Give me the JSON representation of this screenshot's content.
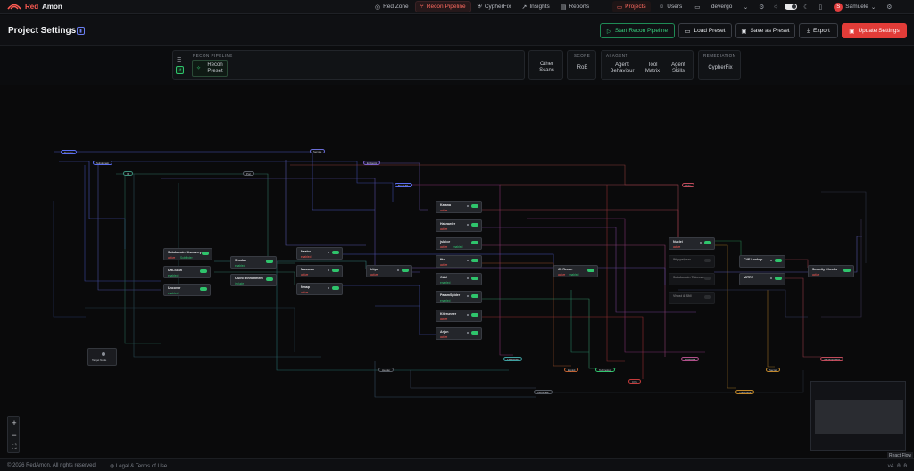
{
  "app": {
    "logo_red": "Red",
    "logo_white": "Amon"
  },
  "nav": {
    "tabs": [
      {
        "icon": "◎",
        "label": "Red Zone"
      },
      {
        "icon": "⑂",
        "label": "Recon Pipeline"
      },
      {
        "icon": "⛨",
        "label": "CypherFix"
      },
      {
        "icon": "↗",
        "label": "Insights"
      },
      {
        "icon": "▤",
        "label": "Reports"
      }
    ],
    "projects_label": "Projects",
    "users_label": "Users",
    "project_select": "devergo",
    "user_initial": "S",
    "user_name": "Samuele"
  },
  "header": {
    "title": "Project Settings",
    "start_label": "Start Recon Pipeline",
    "load_label": "Load Preset",
    "save_label": "Save as Preset",
    "export_label": "Export",
    "update_label": "Update Settings"
  },
  "sections": {
    "recon_label": "RECON PIPELINE",
    "recon_preset": "Recon Preset",
    "other_scans": "Other Scans",
    "scope_label": "SCOPE",
    "roe": "RoE",
    "ai_label": "AI AGENT",
    "agent_behaviour": "Agent Behaviour",
    "tool_matrix": "Tool Matrix",
    "agent_skills": "Agent Skills",
    "remediation_label": "REMEDIATION",
    "cypherfix": "CypherFix"
  },
  "graph": {
    "target_label": "Target Node",
    "nodes": [
      {
        "name": "Subdomain Discovery",
        "status": "active",
        "extra": "Subfinder",
        "ok": false,
        "off": false
      },
      {
        "name": "URLScan",
        "status": "enabled",
        "ok": true,
        "off": false
      },
      {
        "name": "Uncover",
        "status": "enabled",
        "ok": true,
        "off": false
      },
      {
        "name": "Shodan",
        "status": "enabled",
        "ok": true,
        "off": false
      },
      {
        "name": "OSINT Enrichment",
        "status": "include",
        "ok": true,
        "off": false
      },
      {
        "name": "Naabu",
        "status": "enabled",
        "ok": false,
        "off": false
      },
      {
        "name": "Masscan",
        "status": "active",
        "ok": false,
        "off": false
      },
      {
        "name": "Nmap",
        "status": "active",
        "ok": false,
        "off": false
      },
      {
        "name": "httpx",
        "status": "active",
        "ok": false,
        "off": false
      },
      {
        "name": "Katana",
        "status": "active",
        "ok": false,
        "off": false
      },
      {
        "name": "Hakrawler",
        "status": "active",
        "ok": false,
        "off": false
      },
      {
        "name": "jsluice",
        "status": "active",
        "extra": "enabled",
        "ok": false,
        "off": false
      },
      {
        "name": "ffuf",
        "status": "active",
        "ok": false,
        "off": false
      },
      {
        "name": "GAU",
        "status": "enabled",
        "ok": true,
        "off": false
      },
      {
        "name": "ParamSpider",
        "status": "enabled",
        "ok": true,
        "off": false
      },
      {
        "name": "Kiterunner",
        "status": "active",
        "ok": false,
        "off": false
      },
      {
        "name": "Arjun",
        "status": "active",
        "ok": false,
        "off": false
      },
      {
        "name": "JS Recon",
        "status": "active",
        "extra": "enabled",
        "ok": false,
        "off": false
      },
      {
        "name": "Nuclei",
        "status": "active",
        "ok": false,
        "off": false
      },
      {
        "name": "Wappalyzer",
        "status": "",
        "ok": false,
        "off": true
      },
      {
        "name": "Subdomain Takeover",
        "status": "",
        "ok": false,
        "off": true
      },
      {
        "name": "Vhost & SNI",
        "status": "",
        "ok": false,
        "off": true
      },
      {
        "name": "CVE Lookup",
        "status": "",
        "ok": false,
        "off": false
      },
      {
        "name": "MITRE",
        "status": "",
        "ok": false,
        "off": false
      },
      {
        "name": "Security Checks",
        "status": "active",
        "ok": false,
        "off": false
      }
    ],
    "pills": [
      "Domain",
      "Subdomain",
      "IP",
      "Port",
      "Service",
      "Endpoint",
      "BaseURL",
      "Parameter",
      "Technology",
      "Vuln",
      "CVE",
      "Exploit",
      "Secret",
      "Certificate",
      "MitreData",
      "SecurityCheck",
      "Header",
      "Traceroute"
    ]
  },
  "canvas_controls": {
    "zoom_in": "+",
    "zoom_out": "−",
    "fit": "⛶",
    "attribution": "React Flow"
  },
  "footer": {
    "copyright": "© 2026 RedAmon. All rights reserved.",
    "legal": "Legal & Terms of Use",
    "version": "v4.0.0"
  },
  "colors": {
    "accent_red": "#e23c38",
    "accent_green": "#2fc46c",
    "link_blue": "#5b6ef0"
  }
}
